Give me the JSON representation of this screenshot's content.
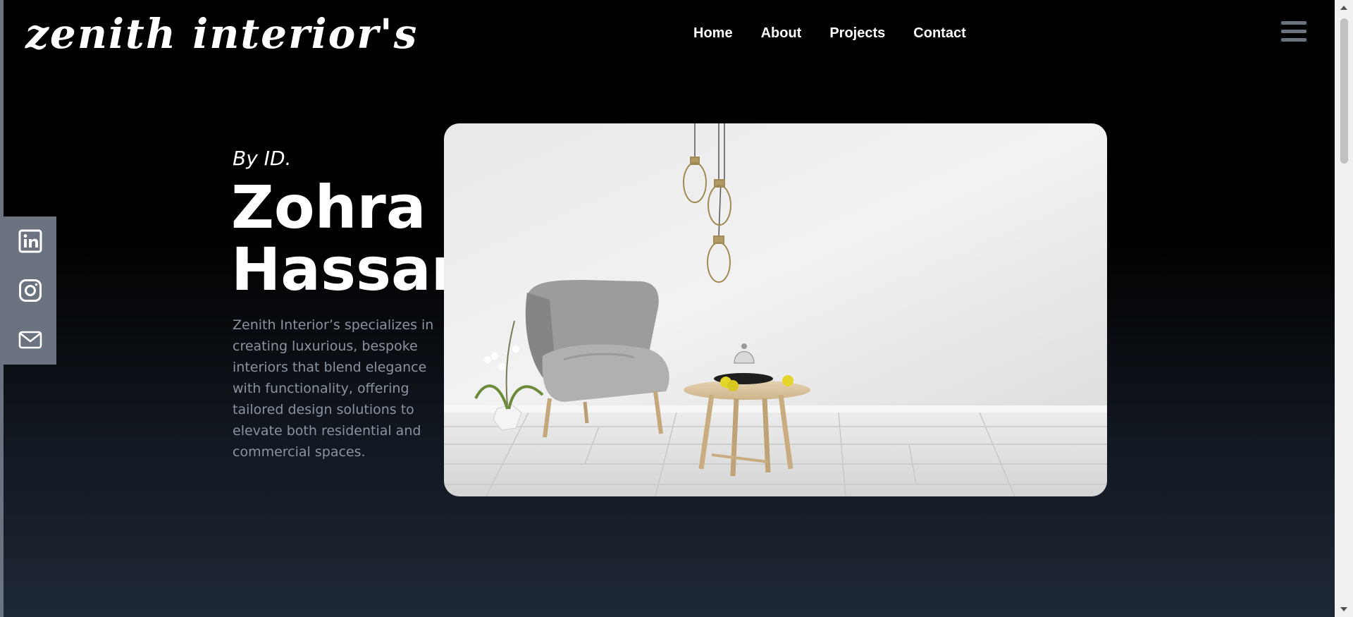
{
  "header": {
    "logo": "zenith interior's",
    "nav": [
      "Home",
      "About",
      "Projects",
      "Contact"
    ],
    "menu_icon": "hamburger-menu-icon"
  },
  "social": {
    "items": [
      {
        "name": "linkedin",
        "icon": "linkedin-icon"
      },
      {
        "name": "instagram",
        "icon": "instagram-icon"
      },
      {
        "name": "email",
        "icon": "mail-icon"
      }
    ]
  },
  "hero": {
    "byline": "By ID.",
    "name_line1": "Zohra",
    "name_line2": "Hassan",
    "description": "Zenith Interior’s specializes in creating luxurious, bespoke interiors that blend elegance with functionality, offering tailored design solutions to elevate both residential and commercial spaces."
  },
  "colors": {
    "background_top": "#000000",
    "background_bottom": "#1e2835",
    "sidebar": "#6b7280",
    "description_text": "#8b93a1"
  }
}
